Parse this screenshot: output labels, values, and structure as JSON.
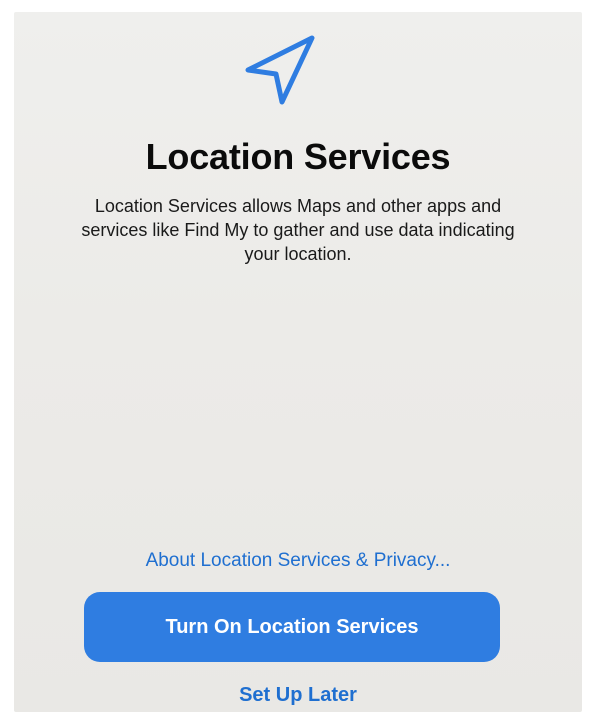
{
  "screen": {
    "title": "Location Services",
    "description": "Location Services allows Maps and other apps and services like Find My to gather and use data indicating your location.",
    "icon": "location-arrow-icon"
  },
  "actions": {
    "about_link": "About Location Services & Privacy...",
    "primary_button": "Turn On Location Services",
    "secondary_link": "Set Up Later"
  },
  "colors": {
    "accent": "#2F7DE1",
    "link": "#1F6FD0",
    "background": "#ECEBE8",
    "title": "#0B0B0B"
  }
}
